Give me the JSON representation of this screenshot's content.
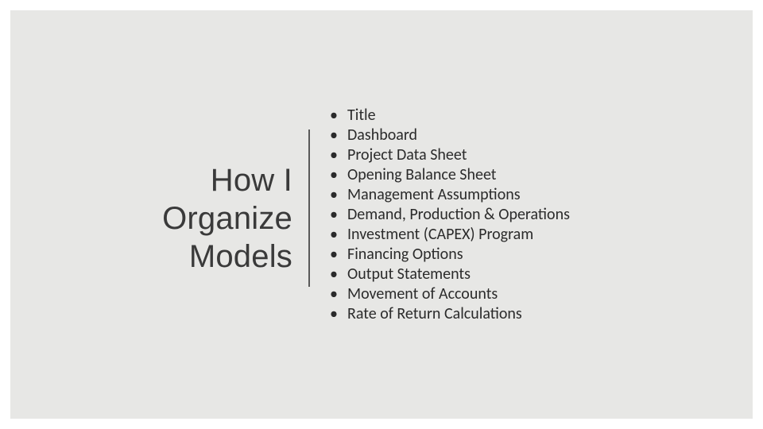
{
  "title": {
    "line1": "How I",
    "line2": "Organize",
    "line3": "Models"
  },
  "items": [
    "Title",
    "Dashboard",
    "Project Data Sheet",
    "Opening Balance Sheet",
    "Management Assumptions",
    "Demand, Production & Operations",
    "Investment (CAPEX) Program",
    "Financing Options",
    "Output Statements",
    "Movement of Accounts",
    "Rate of Return Calculations"
  ]
}
